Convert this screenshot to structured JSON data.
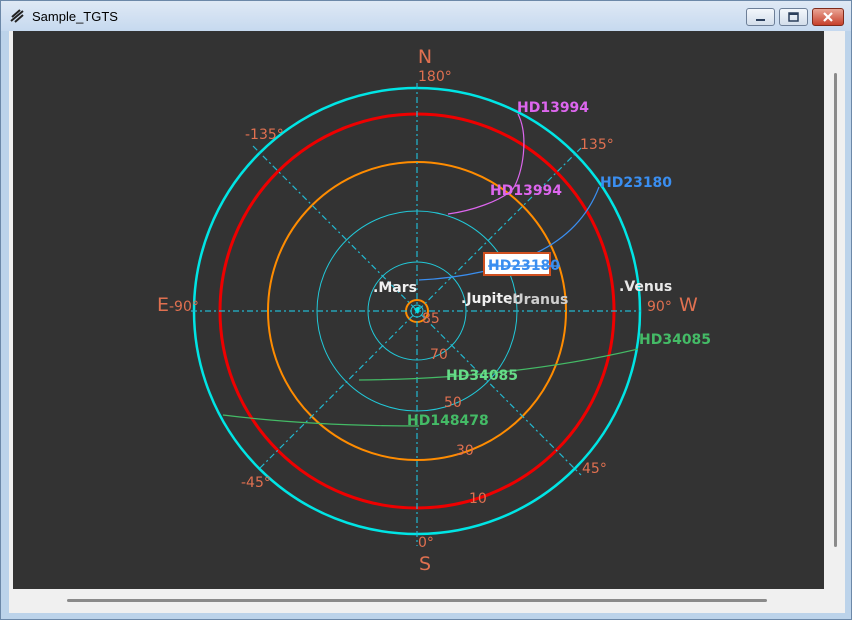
{
  "window": {
    "title": "Sample_TGTS",
    "controls": {
      "minimize_icon": "minimize-icon",
      "maximize_icon": "maximize-icon",
      "close_icon": "close-icon"
    }
  },
  "plot": {
    "type": "polar-sky-chart",
    "colors": {
      "background": "#333333",
      "axis": "#e07050",
      "grid": "#22b8d0",
      "horizon_ring": "#00e5e5",
      "red_ring": "#ee0000",
      "orange_ring": "#ff8c00",
      "magenta": "#dd66ee",
      "blue": "#3a8ef0",
      "green": "#44bb66",
      "planet_label": "#f0f0f0"
    },
    "cardinals": {
      "north": "N",
      "south": "S",
      "east": "E",
      "west": "W"
    },
    "azimuth_labels": {
      "a180": "180°",
      "a0": "0°",
      "a90": "90°",
      "am90": "-90°",
      "a135": "135°",
      "am135": "-135°",
      "a45": "45°",
      "am45": "-45°"
    },
    "altitude_labels": {
      "alt85": "85",
      "alt70": "70",
      "alt50": "50",
      "alt30": "30",
      "alt10": "10"
    },
    "planets": {
      "mars": ".Mars",
      "jupiter": ".Jupiter",
      "uranus": ".Uranus",
      "venus": ".Venus"
    },
    "stars": {
      "hd13994_outer": "HD13994",
      "hd13994_inner": "HD13994",
      "hd23180_outer": "HD23180",
      "hd23180_selected": "HD23180",
      "hd34085_outer": "HD34085",
      "hd34085_inner": "HD34085",
      "hd148478": "HD148478"
    }
  }
}
